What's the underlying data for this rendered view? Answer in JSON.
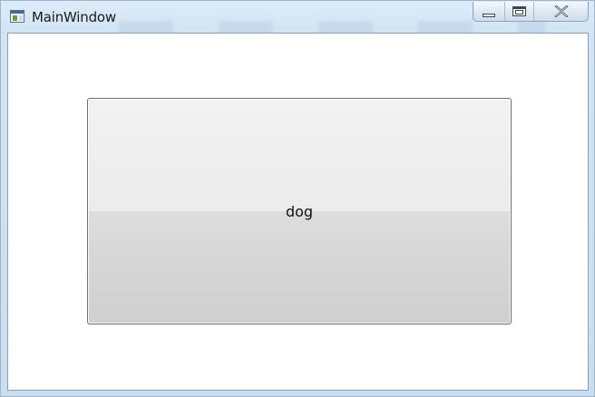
{
  "window": {
    "title": "MainWindow",
    "caption_buttons": [
      "minimize",
      "maximize",
      "close"
    ]
  },
  "content": {
    "button_label": "dog"
  },
  "colors": {
    "frame": "#d2e5f5",
    "client_background": "#ffffff",
    "button_top": "#f2f2f2",
    "button_bottom": "#cfcfcf",
    "button_border": "#707070"
  },
  "icons": {
    "app": "window-app-icon",
    "minimize": "minimize-icon",
    "maximize": "maximize-icon",
    "close": "close-icon"
  }
}
